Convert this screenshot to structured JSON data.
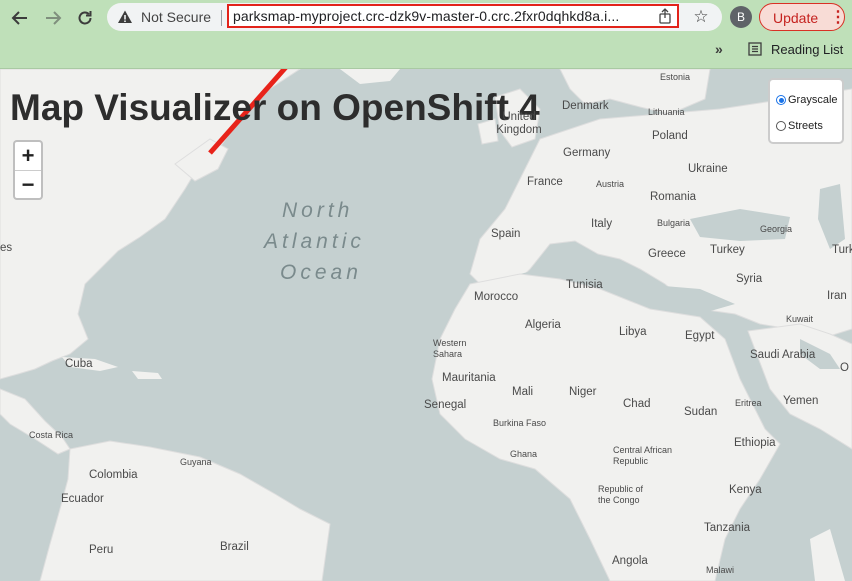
{
  "browser": {
    "security_label": "Not Secure",
    "url": "parksmap-myproject.crc-dzk9v-master-0.crc.2fxr0dqhkd8a.i...",
    "avatar_letter": "B",
    "update_label": "Update",
    "reading_list_label": "Reading List",
    "colors": {
      "chrome_bg": "#bfe0b9",
      "highlight": "#e2231a",
      "update": "#c5221f"
    }
  },
  "map": {
    "title": "Map Visualizer on OpenShift 4",
    "zoom_in": "+",
    "zoom_out": "−",
    "layers": [
      {
        "label": "Grayscale",
        "selected": true
      },
      {
        "label": "Streets",
        "selected": false
      }
    ],
    "ocean": [
      "North",
      "Atlantic",
      "Ocean"
    ],
    "countries": {
      "estonia": "Estonia",
      "denmark": "Denmark",
      "lithuania": "Lithuania",
      "united_kingdom": "United Kingdom",
      "germany": "Germany",
      "poland": "Poland",
      "ukraine": "Ukraine",
      "france": "France",
      "austria": "Austria",
      "romania": "Romania",
      "spain": "Spain",
      "italy": "Italy",
      "bulgaria": "Bulgaria",
      "georgia": "Georgia",
      "turkey": "Turkey",
      "greece": "Greece",
      "turk": "Turk",
      "syria": "Syria",
      "iran": "Iran",
      "tunisia": "Tunisia",
      "morocco": "Morocco",
      "algeria": "Algeria",
      "libya": "Libya",
      "egypt": "Egypt",
      "kuwait": "Kuwait",
      "saudi_arabia": "Saudi Arabia",
      "western_sahara": "Western Sahara",
      "mauritania": "Mauritania",
      "mali": "Mali",
      "niger": "Niger",
      "chad": "Chad",
      "sudan": "Sudan",
      "eritrea": "Eritrea",
      "yemen": "Yemen",
      "senegal": "Senegal",
      "burkina_faso": "Burkina Faso",
      "ghana": "Ghana",
      "central_african_republic": "Central African Republic",
      "ethiopia": "Ethiopia",
      "cuba": "Cuba",
      "costa_rica": "Costa Rica",
      "guyana": "Guyana",
      "colombia": "Colombia",
      "ecuador": "Ecuador",
      "peru": "Peru",
      "brazil": "Brazil",
      "republic_of_the_congo": "Republic of the Congo",
      "kenya": "Kenya",
      "tanzania": "Tanzania",
      "angola": "Angola",
      "malawi": "Malawi",
      "es": "es",
      "o": "O"
    }
  }
}
